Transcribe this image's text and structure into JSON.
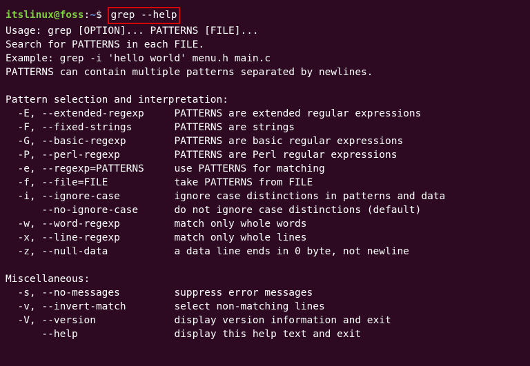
{
  "prompt": {
    "user_host": "itslinux@foss",
    "colon": ":",
    "path": "~",
    "dollar": "$ ",
    "command": "grep --help"
  },
  "usage": "Usage: grep [OPTION]... PATTERNS [FILE]...",
  "search_line": "Search for PATTERNS in each FILE.",
  "example_line": "Example: grep -i 'hello world' menu.h main.c",
  "patterns_line": "PATTERNS can contain multiple patterns separated by newlines.",
  "section1_header": "Pattern selection and interpretation:",
  "options1": [
    {
      "flag": "  -E, --extended-regexp     ",
      "desc": "PATTERNS are extended regular expressions"
    },
    {
      "flag": "  -F, --fixed-strings       ",
      "desc": "PATTERNS are strings"
    },
    {
      "flag": "  -G, --basic-regexp        ",
      "desc": "PATTERNS are basic regular expressions"
    },
    {
      "flag": "  -P, --perl-regexp         ",
      "desc": "PATTERNS are Perl regular expressions"
    },
    {
      "flag": "  -e, --regexp=PATTERNS     ",
      "desc": "use PATTERNS for matching"
    },
    {
      "flag": "  -f, --file=FILE           ",
      "desc": "take PATTERNS from FILE"
    },
    {
      "flag": "  -i, --ignore-case         ",
      "desc": "ignore case distinctions in patterns and data"
    },
    {
      "flag": "      --no-ignore-case      ",
      "desc": "do not ignore case distinctions (default)"
    },
    {
      "flag": "  -w, --word-regexp         ",
      "desc": "match only whole words"
    },
    {
      "flag": "  -x, --line-regexp         ",
      "desc": "match only whole lines"
    },
    {
      "flag": "  -z, --null-data           ",
      "desc": "a data line ends in 0 byte, not newline"
    }
  ],
  "section2_header": "Miscellaneous:",
  "options2": [
    {
      "flag": "  -s, --no-messages         ",
      "desc": "suppress error messages"
    },
    {
      "flag": "  -v, --invert-match        ",
      "desc": "select non-matching lines"
    },
    {
      "flag": "  -V, --version             ",
      "desc": "display version information and exit"
    },
    {
      "flag": "      --help                ",
      "desc": "display this help text and exit"
    }
  ]
}
